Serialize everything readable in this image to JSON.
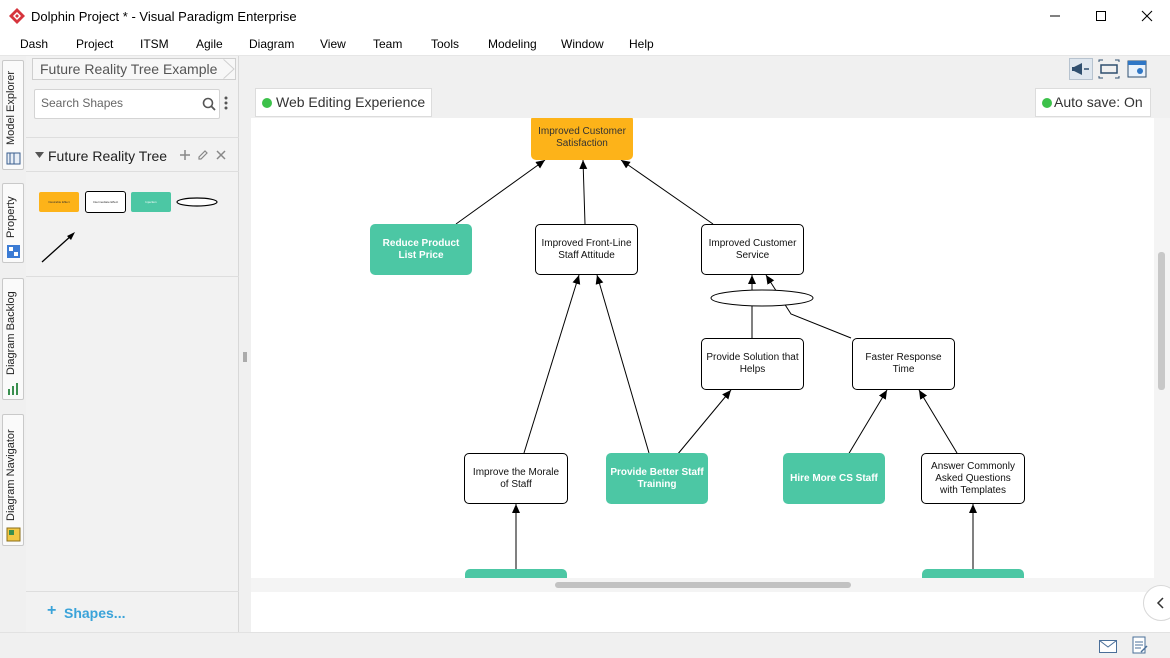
{
  "window": {
    "title": "Dolphin Project * - Visual Paradigm Enterprise"
  },
  "menu": [
    "Dash",
    "Project",
    "ITSM",
    "Agile",
    "Diagram",
    "View",
    "Team",
    "Tools",
    "Modeling",
    "Window",
    "Help"
  ],
  "side_tabs": [
    "Model Explorer",
    "Property",
    "Diagram Backlog",
    "Diagram Navigator"
  ],
  "breadcrumb": "Future Reality Tree Example",
  "search": {
    "placeholder": "Search Shapes"
  },
  "shape_group": {
    "label": "Future Reality Tree"
  },
  "palette": {
    "desirable": "Desirable Effect",
    "intermediate": "Intermediate Effect",
    "injection": "Injection"
  },
  "shapes_link": "Shapes...",
  "chips": {
    "web_editing": "Web Editing Experience",
    "autosave": "Auto save: On"
  },
  "colors": {
    "desirable_effect": "#fdb319",
    "injection": "#4cc7a4",
    "status_dot": "#3cc14a",
    "link": "#3aa3d9"
  },
  "diagram": {
    "nodes": {
      "n_satisfaction": "Improved Customer Satisfaction",
      "n_price": "Reduce Product List Price",
      "n_frontline": "Improved Front-Line Staff Attitude",
      "n_service": "Improved Customer Service",
      "n_solution": "Provide Solution that Helps",
      "n_response": "Faster Response Time",
      "n_morale": "Improve the Morale of Staff",
      "n_training": "Provide Better Staff Training",
      "n_hire": "Hire More CS Staff",
      "n_faq": "Answer Commonly Asked Questions with Templates"
    }
  }
}
